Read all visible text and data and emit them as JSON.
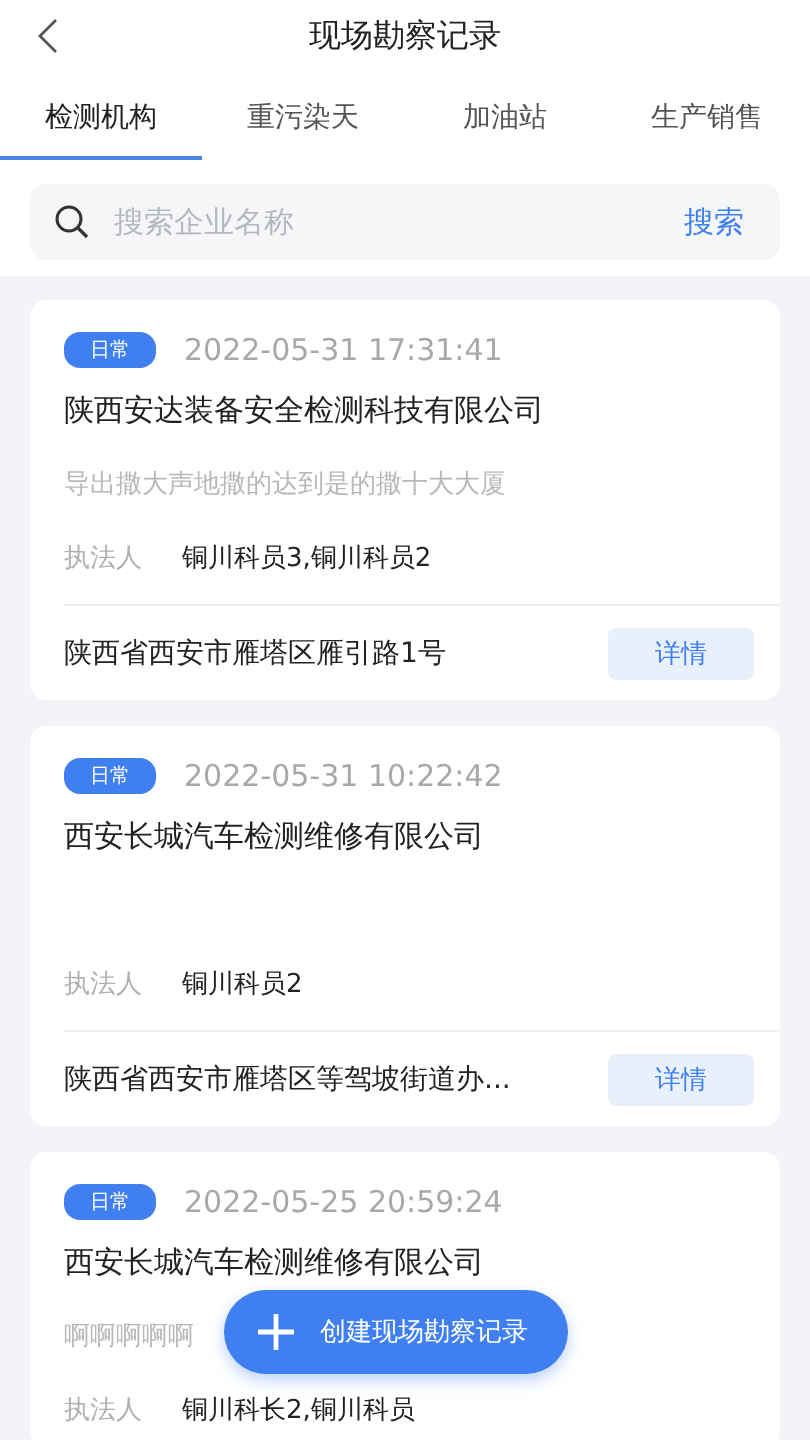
{
  "header": {
    "title": "现场勘察记录"
  },
  "tabs": [
    {
      "label": "检测机构",
      "selected": true
    },
    {
      "label": "重污染天",
      "selected": false
    },
    {
      "label": "加油站",
      "selected": false
    },
    {
      "label": "生产销售",
      "selected": false
    }
  ],
  "search": {
    "placeholder": "搜索企业名称",
    "button": "搜索"
  },
  "records": [
    {
      "tag": "日常",
      "time": "2022-05-31 17:31:41",
      "company": "陕西安达装备安全检测科技有限公司",
      "description": "导出撒大声地撒的达到是的撒十大大厦",
      "executor_label": "执法人",
      "executor": "铜川科员3,铜川科员2",
      "address": "陕西省西安市雁塔区雁引路1号",
      "action": "详情"
    },
    {
      "tag": "日常",
      "time": "2022-05-31 10:22:42",
      "company": "西安长城汽车检测维修有限公司",
      "executor_label": "执法人",
      "executor": "铜川科员2",
      "address": "陕西省西安市雁塔区等驾坡街道办...",
      "action": "详情"
    },
    {
      "tag": "日常",
      "time": "2022-05-25 20:59:24",
      "company": "西安长城汽车检测维修有限公司",
      "description": "啊啊啊啊啊",
      "executor_label": "执法人",
      "executor": "铜川科长2,铜川科员"
    }
  ],
  "create_button": {
    "label": "创建现场勘察记录"
  }
}
